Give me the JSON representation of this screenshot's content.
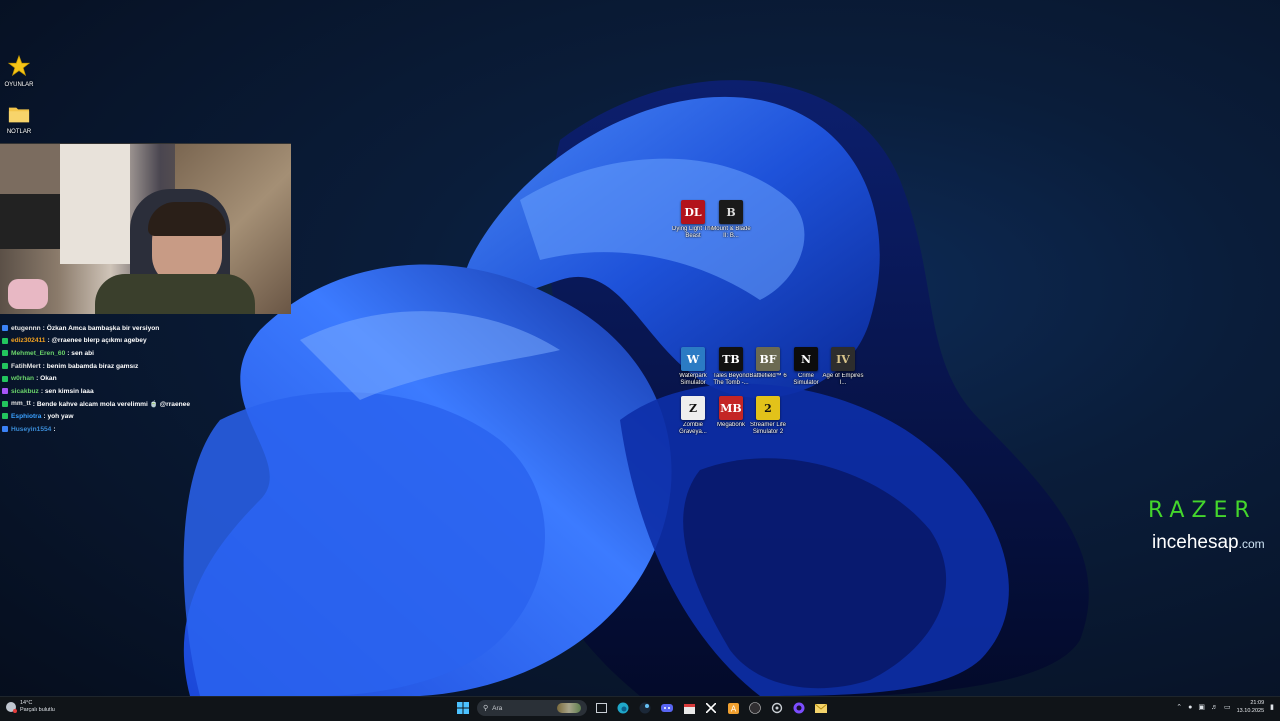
{
  "desktop": {
    "left_icons": [
      {
        "label": "OYUNLAR",
        "icon": "star-icon"
      },
      {
        "label": "NOTLAR",
        "icon": "folder-icon"
      }
    ],
    "icons": [
      {
        "label": "Dying Light The Beast",
        "glyph": "DL",
        "color": "#b3131b"
      },
      {
        "label": "Mount & Blade II: B...",
        "glyph": "B",
        "color": "#1a1a1a"
      },
      {
        "label": "Waterpark Simulator",
        "glyph": "W",
        "color": "#2b7bc4"
      },
      {
        "label": "Tales Beyond The Tomb -...",
        "glyph": "TB",
        "color": "#111111"
      },
      {
        "label": "Battlefield™ 6",
        "glyph": "BF",
        "color": "#6b6a52"
      },
      {
        "label": "Crime Simulator",
        "glyph": "N",
        "color": "#0c0c0c"
      },
      {
        "label": "Age of Empires I...",
        "glyph": "IV",
        "color": "#2d2d2d"
      },
      {
        "label": "Zombie Graveya...",
        "glyph": "Z",
        "color": "#eeeeee"
      },
      {
        "label": "Megabonk",
        "glyph": "MB",
        "color": "#c42525"
      },
      {
        "label": "Streamer Life Simulator 2",
        "glyph": "2",
        "color": "#e2c21a"
      }
    ]
  },
  "chat": {
    "messages": [
      {
        "user": "etugennn",
        "text": ": Özkan Amca bambaşka bir versiyon",
        "user_color": "#e6e6e6",
        "badge": "#3b82f6"
      },
      {
        "user": "ediz302411",
        "text": ": @rraenee blerp açıkmı agebey",
        "user_color": "#f0a020",
        "badge": "#22c55e"
      },
      {
        "user": "Mehmet_Eren_60",
        "text": ": sen abi",
        "user_color": "#6ad36a",
        "badge": "#22c55e"
      },
      {
        "user": "FatihMert",
        "text": ": benim babamda biraz gamsız",
        "user_color": "#e6e6e6",
        "badge": "#22c55e"
      },
      {
        "user": "w0rhan",
        "text": ": Okan",
        "user_color": "#6ad36a",
        "badge": "#22c55e"
      },
      {
        "user": "sicakbuz",
        "text": ": sen kimsin laaa",
        "user_color": "#6ad36a",
        "badge": "#a855f7"
      },
      {
        "user": "mm_tt",
        "text": ": Bende kahve alcam mola verelimmi 🍵 @rraenee",
        "user_color": "#e6e6e6",
        "badge": "#22c55e"
      },
      {
        "user": "Esphiotra",
        "text": ": yoh yaw",
        "user_color": "#3aa0ff",
        "badge": "#22c55e"
      },
      {
        "user": "Huseyin1554",
        "text": ":",
        "user_color": "#3a8bd6",
        "badge": "#3b82f6"
      }
    ]
  },
  "branding": {
    "razer": "RAZER",
    "incehesap_main": "incehesap",
    "incehesap_domain": ".com"
  },
  "taskbar": {
    "weather_temp": "14°C",
    "weather_desc": "Parçalı bulutlu",
    "search_placeholder": "Ara",
    "time": "21:09",
    "date": "13.10.2025",
    "apps": [
      "windows-start-icon",
      "search-box",
      "widgets-icon",
      "file-explorer-icon",
      "edge-icon",
      "steam-icon",
      "discord-icon",
      "calendar-icon",
      "x-icon",
      "app-a-icon",
      "obs-icon",
      "settings-icon",
      "media-icon",
      "mail-icon"
    ]
  },
  "colors": {
    "razer_green": "#44d62c",
    "taskbar_bg": "#101418"
  }
}
